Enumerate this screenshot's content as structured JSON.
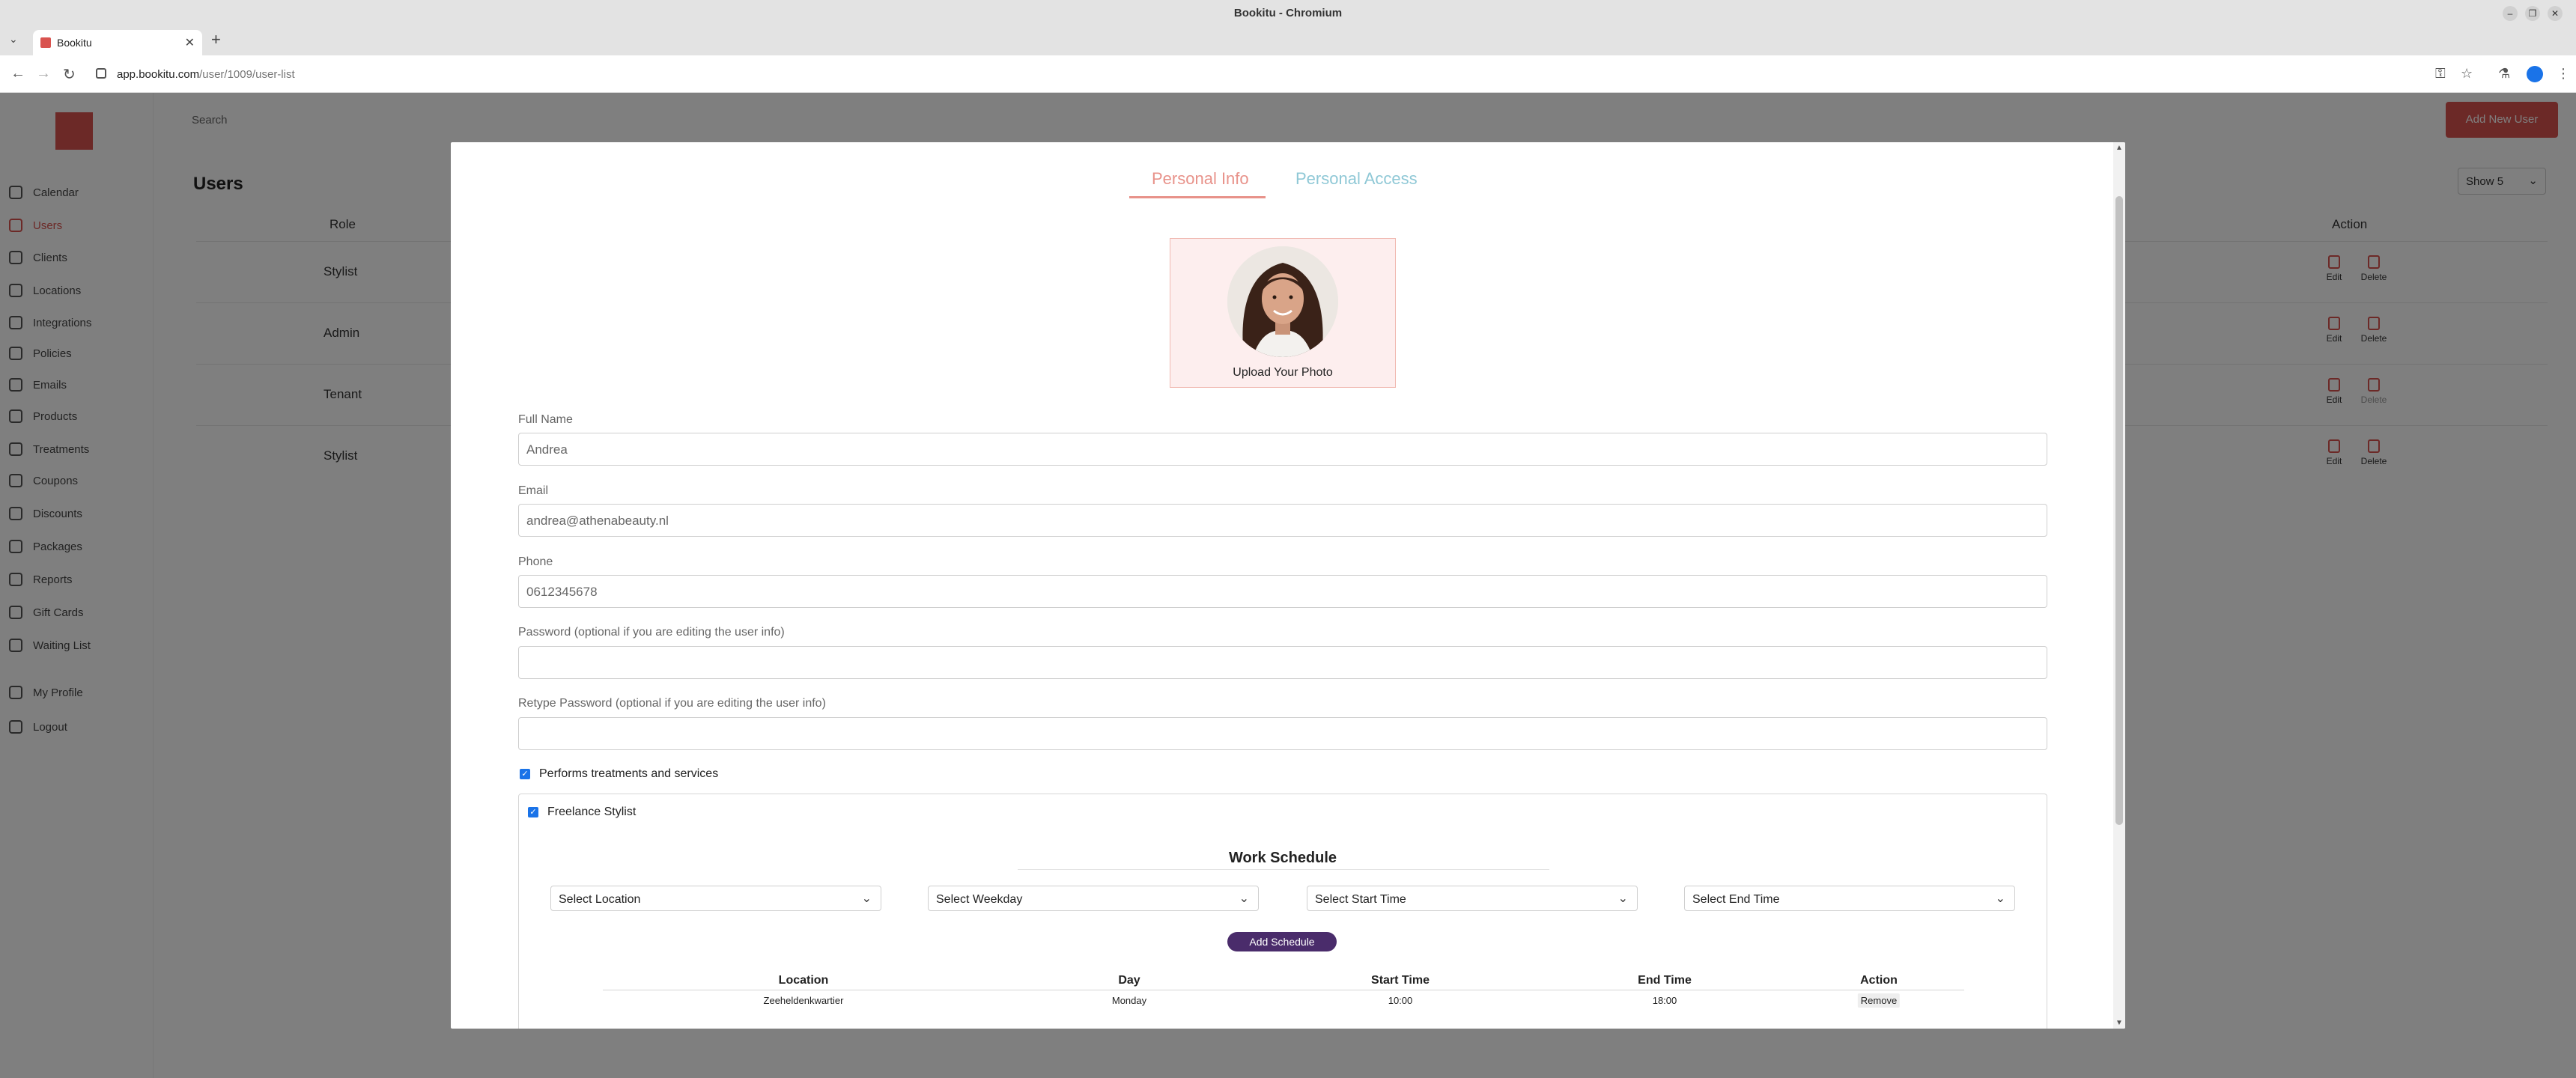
{
  "browser": {
    "window_title": "Bookitu - Chromium",
    "tab_title": "Bookitu",
    "url_host": "app.bookitu.com",
    "url_path": "/user/1009/user-list"
  },
  "app": {
    "search_placeholder": "Search",
    "add_new_user": "Add New User",
    "page_title": "Users",
    "show_select": "Show 5",
    "sidebar": [
      {
        "label": "Calendar",
        "icon": "calendar-icon"
      },
      {
        "label": "Users",
        "icon": "users-icon",
        "active": true
      },
      {
        "label": "Clients",
        "icon": "clients-icon"
      },
      {
        "label": "Locations",
        "icon": "location-pin-icon"
      },
      {
        "label": "Integrations",
        "icon": "integrations-icon"
      },
      {
        "label": "Policies",
        "icon": "policies-icon"
      },
      {
        "label": "Emails",
        "icon": "mail-icon"
      },
      {
        "label": "Products",
        "icon": "products-icon"
      },
      {
        "label": "Treatments",
        "icon": "treatments-icon"
      },
      {
        "label": "Coupons",
        "icon": "coupon-icon"
      },
      {
        "label": "Discounts",
        "icon": "discount-icon"
      },
      {
        "label": "Packages",
        "icon": "package-icon"
      },
      {
        "label": "Reports",
        "icon": "reports-icon"
      },
      {
        "label": "Gift Cards",
        "icon": "gift-card-icon"
      },
      {
        "label": "Waiting List",
        "icon": "waiting-list-icon"
      },
      {
        "label": "My Profile",
        "icon": "profile-icon"
      },
      {
        "label": "Logout",
        "icon": "logout-icon"
      }
    ],
    "table": {
      "headers": {
        "role": "Role",
        "action": "Action"
      },
      "rows": [
        {
          "role": "Stylist",
          "edit": "Edit",
          "delete": "Delete"
        },
        {
          "role": "Admin",
          "edit": "Edit",
          "delete": "Delete"
        },
        {
          "role": "Tenant",
          "edit": "Edit",
          "delete": "Delete"
        },
        {
          "role": "Stylist",
          "edit": "Edit",
          "delete": "Delete"
        }
      ]
    }
  },
  "modal": {
    "tabs": {
      "personal_info": "Personal Info",
      "personal_access": "Personal Access"
    },
    "upload_label": "Upload Your Photo",
    "fields": {
      "full_name_label": "Full Name",
      "full_name_value": "Andrea",
      "email_label": "Email",
      "email_value": "andrea@athenabeauty.nl",
      "phone_label": "Phone",
      "phone_value": "0612345678",
      "password_label": "Password (optional if you are editing the user info)",
      "retype_label": "Retype Password (optional if you are editing the user info)"
    },
    "performs_treatments": {
      "label": "Performs treatments and services",
      "checked": true
    },
    "freelance": {
      "label": "Freelance Stylist",
      "checked": true
    },
    "work_schedule": {
      "title": "Work Schedule",
      "select_location": "Select Location",
      "select_weekday": "Select Weekday",
      "select_start": "Select Start Time",
      "select_end": "Select End Time",
      "add_button": "Add Schedule",
      "headers": {
        "location": "Location",
        "day": "Day",
        "start": "Start Time",
        "end": "End Time",
        "action": "Action"
      },
      "rows": [
        {
          "location": "Zeeheldenkwartier",
          "day": "Monday",
          "start": "10:00",
          "end": "18:00",
          "action": "Remove"
        }
      ]
    }
  },
  "colors": {
    "brand": "#d9534f",
    "tab_active": "#e8928a",
    "tab_inactive": "#8fc8d6",
    "add_schedule": "#4a2c6b"
  }
}
